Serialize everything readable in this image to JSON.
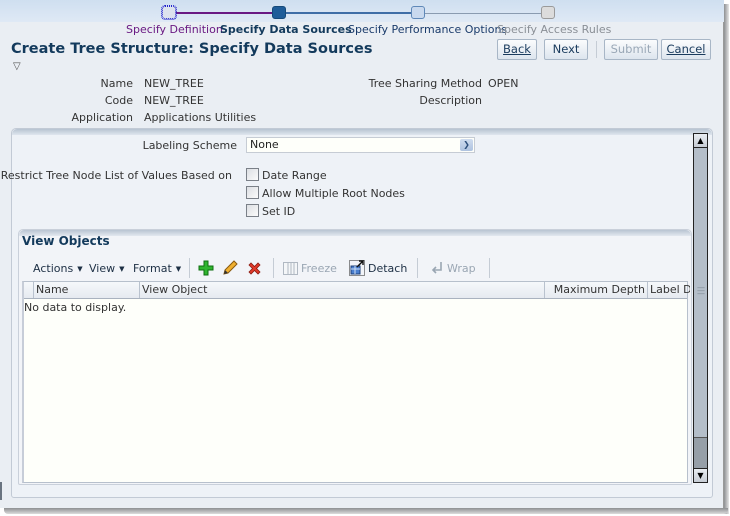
{
  "train": {
    "stops": [
      {
        "label": "Specify Definition",
        "state": "visited"
      },
      {
        "label": "Specify Data Sources",
        "state": "current"
      },
      {
        "label": "Specify Performance Options",
        "state": "next"
      },
      {
        "label": "Specify Access Rules",
        "state": "disabled"
      }
    ],
    "colors": {
      "visited": "#6a1a83",
      "current": "#133a5c",
      "next": "#1a3b6b",
      "disabled": "#8a8f96"
    }
  },
  "header": {
    "title": "Create Tree Structure: Specify Data Sources",
    "disclosure_icon": "triangle-down-outline"
  },
  "buttons": {
    "back": "Back",
    "next": "Next",
    "submit": "Submit",
    "cancel": "Cancel"
  },
  "info": {
    "name_label": "Name",
    "name_value": "NEW_TREE",
    "code_label": "Code",
    "code_value": "NEW_TREE",
    "application_label": "Application",
    "application_value": "Applications Utilities",
    "sharing_label": "Tree Sharing Method",
    "sharing_value": "OPEN",
    "description_label": "Description",
    "description_value": ""
  },
  "form": {
    "labeling_scheme_label": "Labeling Scheme",
    "labeling_scheme_value": "None",
    "restrict_label": "Restrict Tree Node List of Values Based on",
    "checkboxes": [
      {
        "label": "Date Range",
        "checked": false
      },
      {
        "label": "Allow Multiple Root Nodes",
        "checked": false
      },
      {
        "label": "Set ID",
        "checked": false
      }
    ]
  },
  "view_objects": {
    "title": "View Objects",
    "toolbar": {
      "actions": "Actions",
      "view": "View",
      "format": "Format",
      "add_icon": "add-icon",
      "edit_icon": "pencil-icon",
      "delete_icon": "delete-x-icon",
      "freeze": "Freeze",
      "detach": "Detach",
      "wrap": "Wrap"
    },
    "columns": [
      "Name",
      "View Object",
      "Maximum Depth",
      "Label Da"
    ],
    "empty_text": "No data to display."
  }
}
